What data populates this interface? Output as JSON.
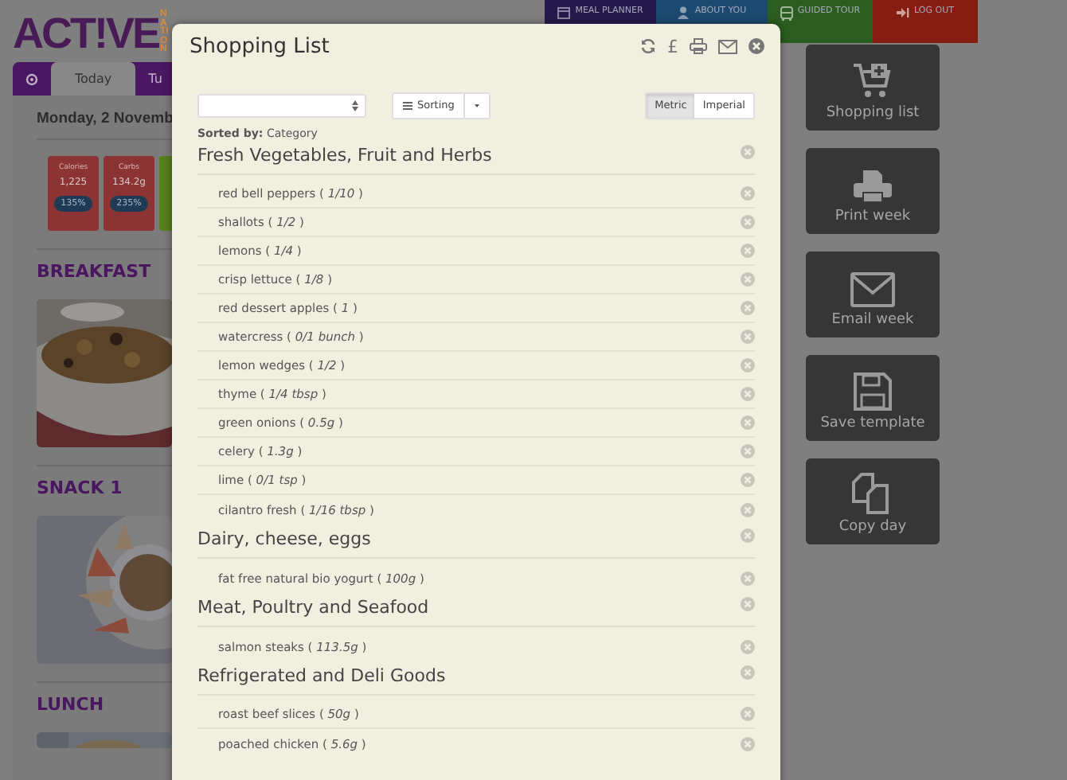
{
  "logo": {
    "title": "ACT!VE",
    "subtitle": "NATION"
  },
  "nav": [
    {
      "label": "MEAL PLANNER",
      "kind": "calendar",
      "color": "#261a4c"
    },
    {
      "label": "ABOUT YOU",
      "kind": "person",
      "color": "#1c4970"
    },
    {
      "label": "GUIDED TOUR",
      "kind": "bus",
      "color": "#2b5d20"
    },
    {
      "label": "LOG OUT",
      "kind": "logout",
      "color": "#861d12"
    }
  ],
  "day_tabs": [
    {
      "kind": "settings",
      "selected": false
    },
    {
      "label": "Today",
      "selected": true
    },
    {
      "label": "Tu",
      "selected": false
    }
  ],
  "date": "Monday, 2 Novemb",
  "nutrients": [
    {
      "label": "Calories",
      "value": "1,225",
      "percent": "135%",
      "color": "#8c3434"
    },
    {
      "label": "Carbs",
      "value": "134.2g",
      "percent": "235%",
      "color": "#8c3434"
    },
    {
      "color": "#56801c"
    }
  ],
  "meals": [
    {
      "title": "BREAKFAST",
      "kind": "granola"
    },
    {
      "title": "SNACK 1",
      "kind": "apple"
    },
    {
      "title": "LUNCH",
      "kind": "lunch"
    }
  ],
  "actions": [
    {
      "label": "Shopping list",
      "kind": "cart"
    },
    {
      "label": "Print week",
      "kind": "print"
    },
    {
      "label": "Email week",
      "kind": "mail"
    },
    {
      "label": "Save template",
      "kind": "save"
    },
    {
      "label": "Copy day",
      "kind": "copy"
    }
  ],
  "modal": {
    "title": "Shopping List",
    "currency": "£",
    "sort_button": "Sorting",
    "units": [
      {
        "label": "Metric",
        "selected": true
      },
      {
        "label": "Imperial",
        "selected": false
      }
    ],
    "sorted_by": "**Sorted by:** Category",
    "sections": [
      {
        "title": "Fresh Vegetables, Fruit and Herbs",
        "items": [
          "red bell peppers ( *1/10* )",
          "shallots ( *1/2* )",
          "lemons ( *1/4* )",
          "crisp lettuce ( *1/8* )",
          "red dessert apples ( *1* )",
          "watercress ( *0/1 bunch* )",
          "lemon wedges ( *1/2* )",
          "thyme ( *1/4 tbsp* )",
          "green onions ( *0.5g* )",
          "celery ( *1.3g* )",
          "lime ( *0/1 tsp* )",
          "cilantro fresh ( *1/16 tbsp* )"
        ]
      },
      {
        "title": "Dairy, cheese, eggs",
        "items": [
          "fat free natural bio yogurt ( *100g* )"
        ]
      },
      {
        "title": "Meat, Poultry and Seafood",
        "items": [
          "salmon steaks ( *113.5g* )"
        ]
      },
      {
        "title": "Refrigerated and Deli Goods",
        "items": [
          "roast beef slices ( *50g* )",
          "poached chicken ( *5.6g* )"
        ]
      }
    ]
  }
}
